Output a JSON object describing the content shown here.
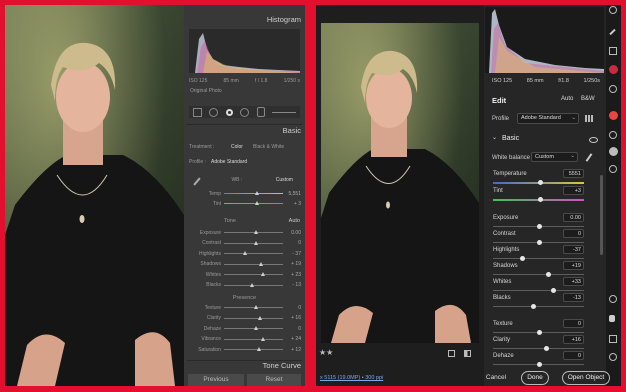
{
  "lightroom_classic": {
    "histogram_title": "Histogram",
    "exif": [
      "ISO 125",
      "85 mm",
      "f / 1.8",
      "1/250 s"
    ],
    "original_photo": "Original Photo",
    "basic_title": "Basic",
    "treatment_label": "Treatment :",
    "treatment_options": [
      "Color",
      "Black & White"
    ],
    "profile_label": "Profile :",
    "profile_value": "Adobe Standard",
    "wb_label": "WB :",
    "wb_value": "Custom",
    "temp_label": "Temp",
    "temp_value": "5,551",
    "tint_label": "Tint",
    "tint_value": "+ 3",
    "tone_label": "Tone",
    "tone_auto": "Auto",
    "sliders": [
      {
        "label": "Exposure",
        "value": "0.00",
        "pos": 0.5
      },
      {
        "label": "Contrast",
        "value": "0",
        "pos": 0.5
      },
      {
        "label": "Highlights",
        "value": "- 37",
        "pos": 0.32
      },
      {
        "label": "Shadows",
        "value": "+ 19",
        "pos": 0.6
      },
      {
        "label": "Whites",
        "value": "+ 23",
        "pos": 0.62
      },
      {
        "label": "Blacks",
        "value": "- 13",
        "pos": 0.44
      }
    ],
    "presence_label": "Presence",
    "presence_sliders": [
      {
        "label": "Texture",
        "value": "0",
        "pos": 0.5
      },
      {
        "label": "Clarity",
        "value": "+ 16",
        "pos": 0.58
      },
      {
        "label": "Dehaze",
        "value": "0",
        "pos": 0.5
      },
      {
        "label": "Vibrance",
        "value": "+ 24",
        "pos": 0.62
      },
      {
        "label": "Saturation",
        "value": "+ 12",
        "pos": 0.56
      }
    ],
    "tone_curve_title": "Tone Curve",
    "previous_button": "Previous",
    "reset_button": "Reset"
  },
  "camera_raw": {
    "exif": [
      "ISO 125",
      "85 mm",
      "f/1.8",
      "1/250s"
    ],
    "edit_title": "Edit",
    "auto_button": "Auto",
    "bw_button": "B&W",
    "profile_label": "Profile",
    "profile_value": "Adobe Standard",
    "basic_title": "Basic",
    "wb_label": "White balance",
    "wb_value": "Custom",
    "temp_label": "Temperature",
    "temp_value": "5551",
    "tint_label": "Tint",
    "tint_value": "+3",
    "sliders": [
      {
        "label": "Exposure",
        "value": "0.00",
        "pos": 0.5
      },
      {
        "label": "Contrast",
        "value": "0",
        "pos": 0.5
      },
      {
        "label": "Highlights",
        "value": "-37",
        "pos": 0.32
      },
      {
        "label": "Shadows",
        "value": "+19",
        "pos": 0.6
      },
      {
        "label": "Whites",
        "value": "+33",
        "pos": 0.66
      },
      {
        "label": "Blacks",
        "value": "-13",
        "pos": 0.44
      },
      {
        "label": "Texture",
        "value": "0",
        "pos": 0.5
      },
      {
        "label": "Clarity",
        "value": "+16",
        "pos": 0.58
      },
      {
        "label": "Dehaze",
        "value": "0",
        "pos": 0.5
      }
    ],
    "file_info": "x 5115 (19.0MP) • 300 ppi",
    "cancel_button": "Cancel",
    "done_button": "Done",
    "open_object_button": "Open Object"
  }
}
